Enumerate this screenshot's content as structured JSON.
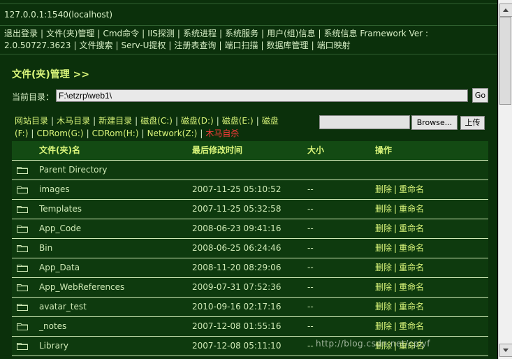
{
  "window": {
    "title": "127.0.0.1:1540(localhost)"
  },
  "menu": {
    "items": [
      "退出登录",
      "文件(夹)管理",
      "Cmd命令",
      "IIS探测",
      "系统进程",
      "系统服务",
      "用户(组)信息",
      "系统信息 Framework Ver : 2.0.50727.3623",
      "文件搜索",
      "Serv-U提权",
      "注册表查询",
      "端口扫描",
      "数据库管理",
      "端口映射"
    ]
  },
  "page": {
    "section_title": "文件(夹)管理 >>"
  },
  "current_dir": {
    "label": "当前目录：",
    "value": "F:\\etzrp\\web1\\",
    "go_label": "Go"
  },
  "quick_links": [
    {
      "label": "网站目录",
      "color": "#d9f57a"
    },
    {
      "label": "木马目录",
      "color": "#d9f57a"
    },
    {
      "label": "新建目录",
      "color": "#d9f57a"
    },
    {
      "label": "磁盘(C:)",
      "color": "#d9f57a"
    },
    {
      "label": "磁盘(D:)",
      "color": "#d9f57a"
    },
    {
      "label": "磁盘(E:)",
      "color": "#d9f57a"
    },
    {
      "label": "磁盘(F:)",
      "color": "#d9f57a"
    },
    {
      "label": "CDRom(G:)",
      "color": "#d9f57a"
    },
    {
      "label": "CDRom(H:)",
      "color": "#d9f57a"
    },
    {
      "label": "Network(Z:)",
      "color": "#d9f57a"
    },
    {
      "label": "木马自杀",
      "color": "#ff3b3b"
    }
  ],
  "upload": {
    "browse_label": "Browse...",
    "upload_label": "上传"
  },
  "table": {
    "headers": {
      "name": "文件(夹)名",
      "time": "最后修改时间",
      "size": "大小",
      "op": "操作"
    },
    "rows": [
      {
        "name": "Parent Directory",
        "time": "",
        "size": "",
        "del": "",
        "rename": ""
      },
      {
        "name": "images",
        "time": "2007-11-25 05:10:52",
        "size": "--",
        "del": "删除",
        "rename": "重命名"
      },
      {
        "name": "Templates",
        "time": "2007-11-25 05:32:58",
        "size": "--",
        "del": "删除",
        "rename": "重命名"
      },
      {
        "name": "App_Code",
        "time": "2008-06-23 09:41:16",
        "size": "--",
        "del": "删除",
        "rename": "重命名"
      },
      {
        "name": "Bin",
        "time": "2008-06-25 06:24:46",
        "size": "--",
        "del": "删除",
        "rename": "重命名"
      },
      {
        "name": "App_Data",
        "time": "2008-11-20 08:29:06",
        "size": "--",
        "del": "删除",
        "rename": "重命名"
      },
      {
        "name": "App_WebReferences",
        "time": "2009-07-31 07:52:36",
        "size": "--",
        "del": "删除",
        "rename": "重命名"
      },
      {
        "name": "avatar_test",
        "time": "2010-09-16 02:17:16",
        "size": "--",
        "del": "删除",
        "rename": "重命名"
      },
      {
        "name": "_notes",
        "time": "2007-12-08 01:55:16",
        "size": "--",
        "del": "删除",
        "rename": "重命名"
      },
      {
        "name": "Library",
        "time": "2007-12-08 05:11:10",
        "size": "--",
        "del": "删除",
        "rename": "重命名"
      }
    ]
  },
  "watermark": "http://blog.csdn.net/cplyf",
  "colors": {
    "background": "#0b300b",
    "accent": "#d9f57a",
    "danger": "#ff3b3b",
    "text": "#cfe9b6"
  }
}
